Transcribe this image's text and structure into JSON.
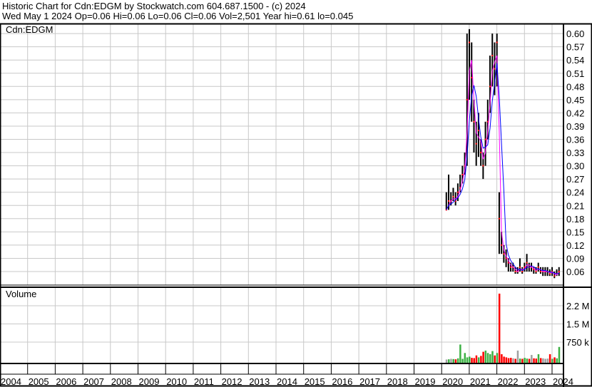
{
  "header": {
    "title": "Historic Chart for Cdn:EDGM by Stockwatch.com 604.687.1500 - (c) 2024",
    "quote": "Wed May  1 2024   Op=0.06  Hi=0.06  Lo=0.06  Cl=0.06  Vol=2,501  Year hi=0.61  lo=0.045"
  },
  "chart_data": {
    "type": "line",
    "symbol": "Cdn:EDGM",
    "volume_label": "Volume",
    "price_ticks": [
      "0.60",
      "0.57",
      "0.54",
      "0.51",
      "0.48",
      "0.45",
      "0.42",
      "0.39",
      "0.36",
      "0.33",
      "0.30",
      "0.27",
      "0.24",
      "0.21",
      "0.18",
      "0.15",
      "0.12",
      "0.09",
      "0.06"
    ],
    "volume_ticks": [
      {
        "label": "2.2 M",
        "value": 2250000
      },
      {
        "label": "1.5 M",
        "value": 1500000
      },
      {
        "label": "750 k",
        "value": 750000
      }
    ],
    "year_labels": [
      "2004",
      "2005",
      "2006",
      "2007",
      "2008",
      "2009",
      "2010",
      "2011",
      "2012",
      "2013",
      "2014",
      "2015",
      "2016",
      "2017",
      "2018",
      "2019",
      "2020",
      "2021",
      "2022",
      "2023",
      "2024"
    ],
    "ylim": [
      0.045,
      0.61
    ],
    "x_start": 2020.17,
    "x_step": 0.0833,
    "close": [
      0.2,
      0.22,
      0.22,
      0.23,
      0.22,
      0.24,
      0.25,
      0.28,
      0.3,
      0.45,
      0.58,
      0.5,
      0.4,
      0.35,
      0.38,
      0.33,
      0.3,
      0.36,
      0.4,
      0.48,
      0.55,
      0.52,
      0.58,
      0.18,
      0.12,
      0.1,
      0.09,
      0.08,
      0.07,
      0.07,
      0.06,
      0.06,
      0.07,
      0.06,
      0.07,
      0.08,
      0.07,
      0.07,
      0.065,
      0.06,
      0.07,
      0.06,
      0.06,
      0.06,
      0.06,
      0.055,
      0.06,
      0.05,
      0.055,
      0.06
    ],
    "high": [
      0.24,
      0.28,
      0.24,
      0.25,
      0.24,
      0.26,
      0.28,
      0.3,
      0.33,
      0.6,
      0.61,
      0.58,
      0.45,
      0.4,
      0.42,
      0.36,
      0.33,
      0.4,
      0.45,
      0.55,
      0.6,
      0.58,
      0.6,
      0.24,
      0.15,
      0.12,
      0.11,
      0.09,
      0.08,
      0.08,
      0.07,
      0.07,
      0.09,
      0.07,
      0.08,
      0.1,
      0.08,
      0.08,
      0.07,
      0.07,
      0.08,
      0.07,
      0.07,
      0.07,
      0.07,
      0.065,
      0.07,
      0.06,
      0.065,
      0.07
    ],
    "low": [
      0.2,
      0.2,
      0.21,
      0.22,
      0.21,
      0.22,
      0.24,
      0.26,
      0.28,
      0.3,
      0.45,
      0.4,
      0.33,
      0.3,
      0.32,
      0.3,
      0.27,
      0.3,
      0.36,
      0.42,
      0.48,
      0.46,
      0.48,
      0.1,
      0.1,
      0.08,
      0.07,
      0.06,
      0.06,
      0.06,
      0.055,
      0.055,
      0.06,
      0.055,
      0.06,
      0.06,
      0.06,
      0.06,
      0.055,
      0.055,
      0.06,
      0.055,
      0.05,
      0.05,
      0.05,
      0.05,
      0.05,
      0.045,
      0.05,
      0.05
    ],
    "volume": [
      30000,
      40000,
      60000,
      50000,
      40000,
      80000,
      650000,
      60000,
      300000,
      120000,
      150000,
      100000,
      90000,
      200000,
      120000,
      180000,
      350000,
      400000,
      300000,
      250000,
      380000,
      200000,
      300000,
      2750000,
      250000,
      150000,
      120000,
      90000,
      100000,
      80000,
      60000,
      400000,
      70000,
      60000,
      100000,
      70000,
      60000,
      220000,
      80000,
      70000,
      250000,
      90000,
      80000,
      60000,
      70000,
      250000,
      60000,
      120000,
      80000,
      550000
    ],
    "colors": {
      "price": "#000000",
      "dots": "#ff0000",
      "ma_short": "#ff00ff",
      "ma_long": "#0000ff",
      "grid": "#c8c8c8",
      "vol_up": "#3cb043",
      "vol_down": "#ff0000",
      "vol_flat": "#a0a0a0"
    }
  }
}
